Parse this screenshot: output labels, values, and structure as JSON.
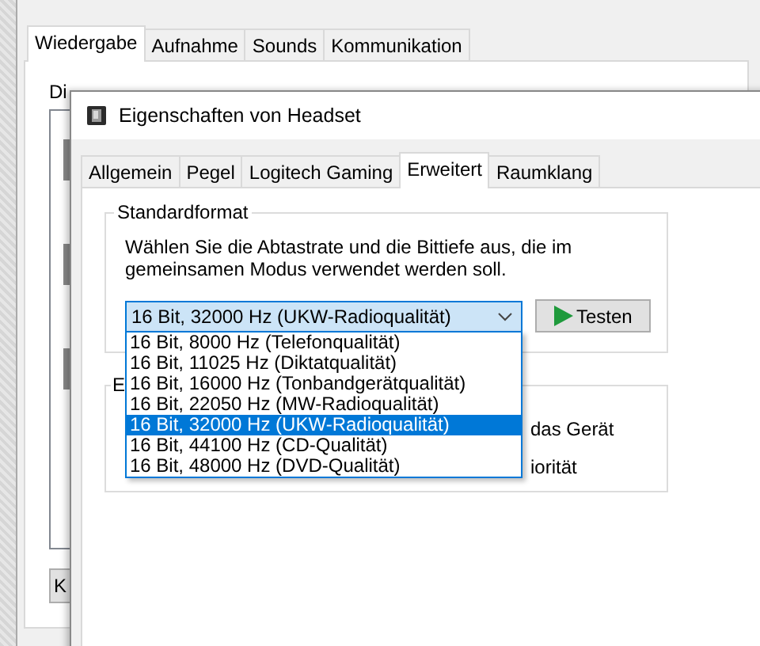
{
  "sound_window": {
    "tabs": [
      {
        "label": "Wiedergabe",
        "selected": true
      },
      {
        "label": "Aufnahme",
        "selected": false
      },
      {
        "label": "Sounds",
        "selected": false
      },
      {
        "label": "Kommunikation",
        "selected": false
      }
    ],
    "intro_text": "Di",
    "button_text": "K"
  },
  "dialog": {
    "title": "Eigenschaften von Headset",
    "tabs": [
      {
        "label": "Allgemein",
        "selected": false
      },
      {
        "label": "Pegel",
        "selected": false
      },
      {
        "label": "Logitech Gaming",
        "selected": false
      },
      {
        "label": "Erweitert",
        "selected": true
      },
      {
        "label": "Raumklang",
        "selected": false
      }
    ],
    "default_format": {
      "title": "Standardformat",
      "description": "Wählen Sie die Abtastrate und die Bittiefe aus, die im gemeinsamen Modus verwendet werden soll.",
      "value": "16 Bit, 32000 Hz (UKW-Radioqualität)",
      "expanded": true,
      "options": [
        {
          "label": "16 Bit, 8000 Hz (Telefonqualität)",
          "selected": false
        },
        {
          "label": "16 Bit, 11025 Hz (Diktatqualität)",
          "selected": false
        },
        {
          "label": "16 Bit, 16000 Hz (Tonbandgerätqualität)",
          "selected": false
        },
        {
          "label": "16 Bit, 22050 Hz (MW-Radioqualität)",
          "selected": false
        },
        {
          "label": "16 Bit, 32000 Hz (UKW-Radioqualität)",
          "selected": true
        },
        {
          "label": "16 Bit, 44100 Hz (CD-Qualität)",
          "selected": false
        },
        {
          "label": "16 Bit, 48000 Hz (DVD-Qualität)",
          "selected": false
        }
      ],
      "test_button": "Testen"
    },
    "exclusive_group": {
      "title": "E",
      "lines": [
        "das Gerät",
        "iorität"
      ]
    }
  }
}
